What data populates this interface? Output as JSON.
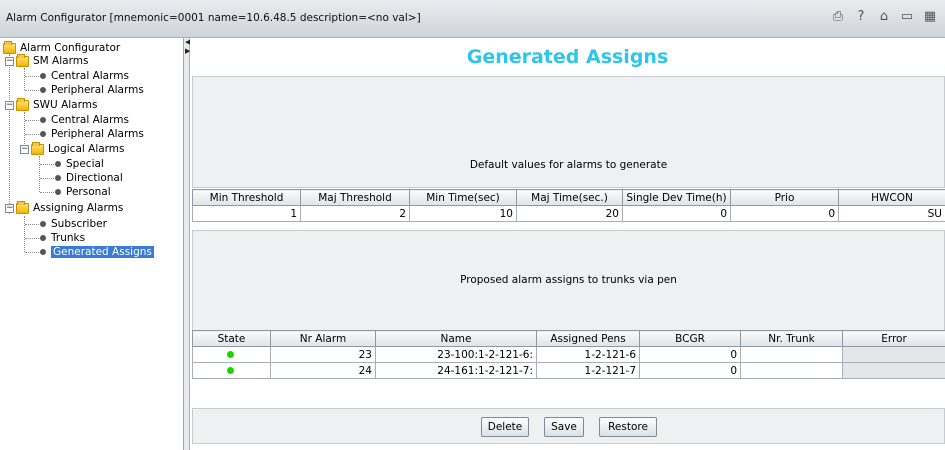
{
  "window": {
    "title": "Alarm Configurator [mnemonic=0001 name=10.6.48.5 description=<no val>]",
    "icons": [
      "print-icon",
      "help-icon",
      "home-icon",
      "export-icon",
      "config-icon"
    ]
  },
  "tree": {
    "root": "Alarm Configurator",
    "sm_alarms": "SM Alarms",
    "sm_central": "Central Alarms",
    "sm_peripheral": "Peripheral Alarms",
    "swu_alarms": "SWU Alarms",
    "swu_central": "Central Alarms",
    "swu_peripheral": "Peripheral Alarms",
    "logical_alarms": "Logical Alarms",
    "special": "Special",
    "directional": "Directional",
    "personal": "Personal",
    "assigning_alarms": "Assigning Alarms",
    "subscriber": "Subscriber",
    "trunks": "Trunks",
    "generated_assigns": "Generated Assigns",
    "selected": "Generated Assigns"
  },
  "main": {
    "heading": "Generated Assigns",
    "defaults_caption": "Default values for alarms to generate",
    "defaults_table": {
      "headers": [
        "Min Threshold",
        "Maj Threshold",
        "Min Time(sec)",
        "Maj Time(sec.)",
        "Single Dev Time(h)",
        "Prio",
        "HWCON"
      ],
      "row": [
        "1",
        "2",
        "10",
        "20",
        "0",
        "0",
        "SU"
      ]
    },
    "proposed_caption": "Proposed alarm assigns to trunks via pen",
    "assigns_table": {
      "headers": [
        "State",
        "Nr Alarm",
        "Name",
        "Assigned Pens",
        "BCGR",
        "Nr. Trunk",
        "Error"
      ],
      "rows": [
        {
          "state": "ok",
          "nr_alarm": "23",
          "name": "23-100:1-2-121-6:",
          "assigned_pens": "1-2-121-6",
          "bcgr": "0",
          "nr_trunk": "",
          "error": ""
        },
        {
          "state": "ok",
          "nr_alarm": "24",
          "name": "24-161:1-2-121-7:",
          "assigned_pens": "1-2-121-7",
          "bcgr": "0",
          "nr_trunk": "",
          "error": ""
        }
      ]
    },
    "buttons": {
      "delete": "Delete",
      "save": "Save",
      "restore": "Restore"
    }
  },
  "colors": {
    "heading": "#2ec6e8",
    "state_ok": "#1ed400",
    "selection": "#3a7bd5"
  }
}
